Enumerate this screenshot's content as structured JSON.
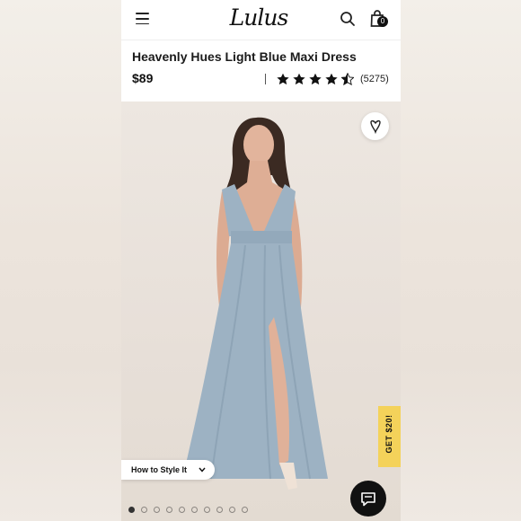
{
  "header": {
    "logo_text": "Lulus",
    "bag_count": "0",
    "icons": [
      "menu-icon",
      "search-icon",
      "bag-icon"
    ]
  },
  "product": {
    "title": "Heavenly Hues Light Blue Maxi Dress",
    "price": "$89",
    "rating_stars": 4.5,
    "review_count": "(5275)"
  },
  "gallery": {
    "style_button_label": "How to Style It",
    "promo_tab_label": "GET $20!",
    "dot_count": 10,
    "active_dot": 0,
    "dress_color": "#9db2c3"
  },
  "colors": {
    "promo_yellow": "#f4d25a",
    "chat_button": "#111111"
  }
}
